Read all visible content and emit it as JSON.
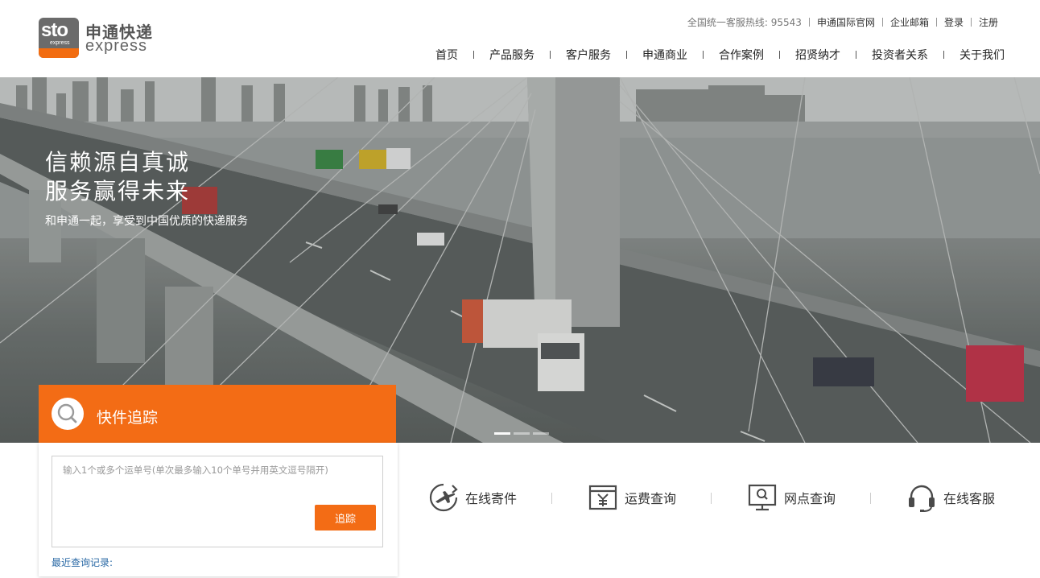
{
  "brand": {
    "mark_text": "sto",
    "mark_sub": "express",
    "name_cn": "申通快递",
    "name_en": "express",
    "accent_color": "#f36c15"
  },
  "toplinks": {
    "hotline": "全国统一客服热线: 95543",
    "items": [
      "申通国际官网",
      "企业邮箱",
      "登录",
      "注册"
    ]
  },
  "nav": {
    "items": [
      "首页",
      "产品服务",
      "客户服务",
      "申通商业",
      "合作案例",
      "招贤纳才",
      "投资者关系",
      "关于我们"
    ]
  },
  "banner": {
    "slogan_line1": "信赖源自真诚",
    "slogan_line2": "服务赢得未来",
    "subtitle": "和申通一起，享受到中国优质的快递服务",
    "slides": 3,
    "active_slide": 1
  },
  "tracking": {
    "title": "快件追踪",
    "placeholder": "输入1个或多个运单号(单次最多输入10个单号并用英文逗号隔开)",
    "value": "",
    "button": "追踪",
    "recent_label": "最近查询记录:"
  },
  "quick_services": [
    {
      "label": "在线寄件",
      "icon": "airplane-send-icon"
    },
    {
      "label": "运费查询",
      "icon": "yuan-price-icon"
    },
    {
      "label": "网点查询",
      "icon": "monitor-search-icon"
    },
    {
      "label": "在线客服",
      "icon": "headset-icon"
    }
  ]
}
